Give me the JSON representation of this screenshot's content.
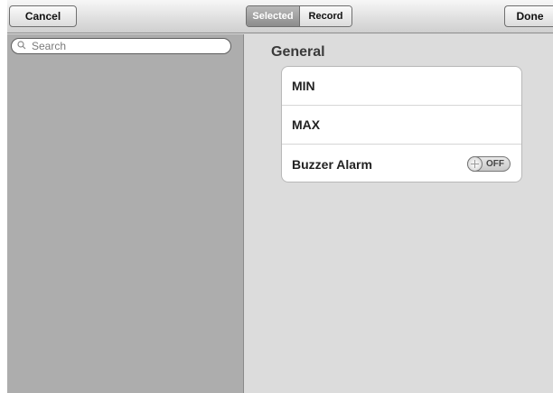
{
  "toolbar": {
    "cancel_label": "Cancel",
    "done_label": "Done",
    "segments": [
      {
        "label": "Selected",
        "active": true
      },
      {
        "label": "Record",
        "active": false
      }
    ]
  },
  "sidebar": {
    "search": {
      "placeholder": "Search",
      "value": "",
      "icon": "search-icon"
    }
  },
  "main": {
    "section_title": "General",
    "rows": [
      {
        "label": "MIN"
      },
      {
        "label": "MAX"
      },
      {
        "label": "Buzzer Alarm",
        "toggle": {
          "state": "OFF",
          "on": false,
          "icon": "toggle-knob-icon"
        }
      }
    ]
  },
  "colors": {
    "pane_left": "#adadad",
    "pane_right": "#dcdcdc",
    "card": "#ffffff"
  }
}
